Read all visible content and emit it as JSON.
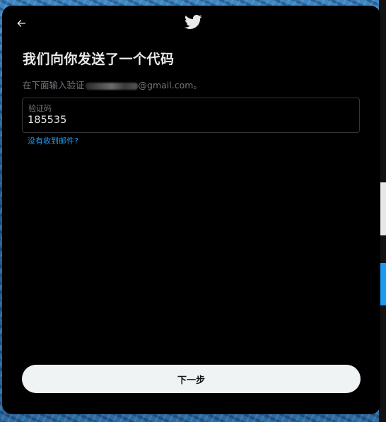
{
  "dialog": {
    "title": "我们向你发送了一个代码",
    "subtitle_prefix": "在下面输入验证",
    "subtitle_suffix": "@gmail.com。",
    "code_field": {
      "label": "验证码",
      "value": "185535"
    },
    "resend_link": "没有收到邮件?",
    "next_button": "下一步"
  },
  "icons": {
    "back": "back-arrow-icon",
    "logo": "twitter-bird-logo"
  },
  "colors": {
    "modal_background": "#000000",
    "title_text": "#e7e9ea",
    "secondary_text": "#71767b",
    "link": "#1d9bf0",
    "field_border": "#333639",
    "button_background": "#eff3f4",
    "button_text": "#0f1419"
  }
}
